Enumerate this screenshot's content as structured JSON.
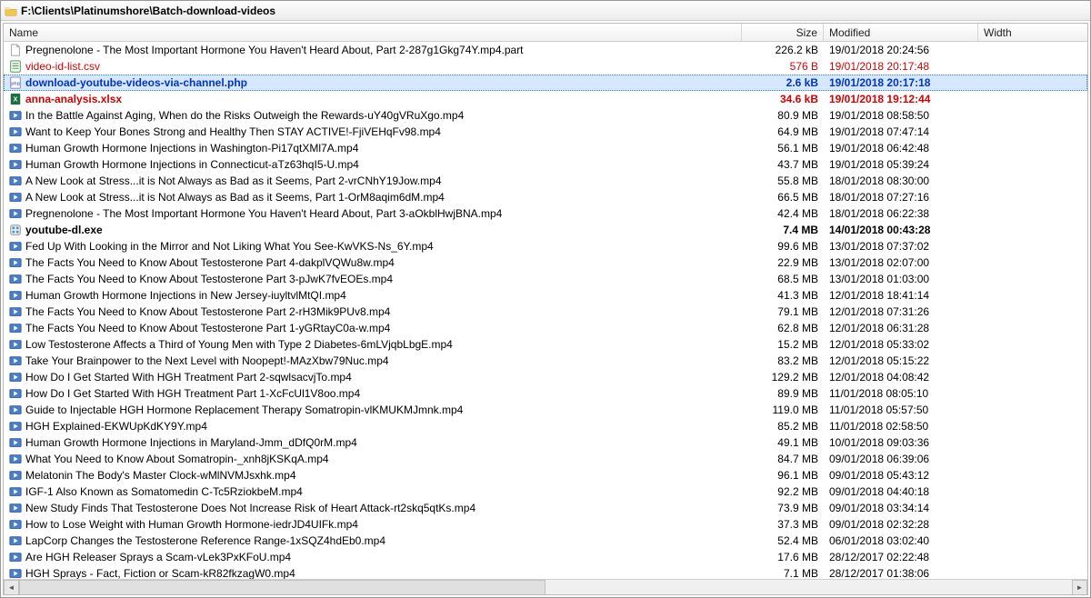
{
  "title": "F:\\Clients\\Platinumshore\\Batch-download-videos",
  "columns": {
    "name": "Name",
    "size": "Size",
    "modified": "Modified",
    "width": "Width"
  },
  "rows": [
    {
      "icon": "file",
      "name": "Pregnenolone - The Most Important Hormone You Haven't Heard About, Part 2-287g1Gkg74Y.mp4.part",
      "size": "226.2 kB",
      "modified": "19/01/2018 20:24:56",
      "style": ""
    },
    {
      "icon": "csv",
      "name": "video-id-list.csv",
      "size": "576 B",
      "modified": "19/01/2018 20:17:48",
      "style": "red"
    },
    {
      "icon": "php",
      "name": "download-youtube-videos-via-channel.php",
      "size": "2.6 kB",
      "modified": "19/01/2018 20:17:18",
      "style": "blue selected"
    },
    {
      "icon": "xlsx",
      "name": "anna-analysis.xlsx",
      "size": "34.6 kB",
      "modified": "19/01/2018 19:12:44",
      "style": "red bold"
    },
    {
      "icon": "video",
      "name": "In the Battle Against Aging, When do the Risks Outweigh the Rewards-uY40gVRuXgo.mp4",
      "size": "80.9 MB",
      "modified": "19/01/2018 08:58:50",
      "style": ""
    },
    {
      "icon": "video",
      "name": "Want to Keep Your Bones Strong and Healthy Then STAY ACTIVE!-FjiVEHqFv98.mp4",
      "size": "64.9 MB",
      "modified": "19/01/2018 07:47:14",
      "style": ""
    },
    {
      "icon": "video",
      "name": "Human Growth Hormone Injections in Washington-Pi17qtXMl7A.mp4",
      "size": "56.1 MB",
      "modified": "19/01/2018 06:42:48",
      "style": ""
    },
    {
      "icon": "video",
      "name": "Human Growth Hormone Injections in Connecticut-aTz63hqI5-U.mp4",
      "size": "43.7 MB",
      "modified": "19/01/2018 05:39:24",
      "style": ""
    },
    {
      "icon": "video",
      "name": "A New Look at Stress...it is Not Always as Bad as it Seems, Part 2-vrCNhY19Jow.mp4",
      "size": "55.8 MB",
      "modified": "18/01/2018 08:30:00",
      "style": ""
    },
    {
      "icon": "video",
      "name": "A New Look at Stress...it is Not Always as Bad as it Seems, Part 1-OrM8aqim6dM.mp4",
      "size": "66.5 MB",
      "modified": "18/01/2018 07:27:16",
      "style": ""
    },
    {
      "icon": "video",
      "name": "Pregnenolone - The Most Important Hormone You Haven't Heard About, Part 3-aOkblHwjBNA.mp4",
      "size": "42.4 MB",
      "modified": "18/01/2018 06:22:38",
      "style": ""
    },
    {
      "icon": "exe",
      "name": "youtube-dl.exe",
      "size": "7.4 MB",
      "modified": "14/01/2018 00:43:28",
      "style": "bold"
    },
    {
      "icon": "video",
      "name": "Fed Up With Looking in the Mirror and Not Liking What You See-KwVKS-Ns_6Y.mp4",
      "size": "99.6 MB",
      "modified": "13/01/2018 07:37:02",
      "style": ""
    },
    {
      "icon": "video",
      "name": "The Facts You Need to Know About Testosterone Part 4-dakplVQWu8w.mp4",
      "size": "22.9 MB",
      "modified": "13/01/2018 02:07:00",
      "style": ""
    },
    {
      "icon": "video",
      "name": "The Facts You Need to Know About Testosterone Part 3-pJwK7fvEOEs.mp4",
      "size": "68.5 MB",
      "modified": "13/01/2018 01:03:00",
      "style": ""
    },
    {
      "icon": "video",
      "name": "Human Growth Hormone Injections in New Jersey-iuyltvlMtQI.mp4",
      "size": "41.3 MB",
      "modified": "12/01/2018 18:41:14",
      "style": ""
    },
    {
      "icon": "video",
      "name": "The Facts You Need to Know About Testosterone Part 2-rH3Mik9PUv8.mp4",
      "size": "79.1 MB",
      "modified": "12/01/2018 07:31:26",
      "style": ""
    },
    {
      "icon": "video",
      "name": "The Facts You Need to Know About Testosterone Part 1-yGRtayC0a-w.mp4",
      "size": "62.8 MB",
      "modified": "12/01/2018 06:31:28",
      "style": ""
    },
    {
      "icon": "video",
      "name": "Low Testosterone Affects a Third of Young Men with Type 2 Diabetes-6mLVjqbLbgE.mp4",
      "size": "15.2 MB",
      "modified": "12/01/2018 05:33:02",
      "style": ""
    },
    {
      "icon": "video",
      "name": "Take Your Brainpower to the Next Level with Noopept!-MAzXbw79Nuc.mp4",
      "size": "83.2 MB",
      "modified": "12/01/2018 05:15:22",
      "style": ""
    },
    {
      "icon": "video",
      "name": "How Do I Get Started With HGH Treatment Part 2-sqwlsacvjTo.mp4",
      "size": "129.2 MB",
      "modified": "12/01/2018 04:08:42",
      "style": ""
    },
    {
      "icon": "video",
      "name": "How Do I Get Started With HGH Treatment Part 1-XcFcUl1V8oo.mp4",
      "size": "89.9 MB",
      "modified": "11/01/2018 08:05:10",
      "style": ""
    },
    {
      "icon": "video",
      "name": "Guide to Injectable HGH Hormone Replacement Therapy Somatropin-vlKMUKMJmnk.mp4",
      "size": "119.0 MB",
      "modified": "11/01/2018 05:57:50",
      "style": ""
    },
    {
      "icon": "video",
      "name": "HGH Explained-EKWUpKdKY9Y.mp4",
      "size": "85.2 MB",
      "modified": "11/01/2018 02:58:50",
      "style": ""
    },
    {
      "icon": "video",
      "name": "Human Growth Hormone Injections in Maryland-Jmm_dDfQ0rM.mp4",
      "size": "49.1 MB",
      "modified": "10/01/2018 09:03:36",
      "style": ""
    },
    {
      "icon": "video",
      "name": "What You Need to Know About Somatropin-_xnh8jKSKqA.mp4",
      "size": "84.7 MB",
      "modified": "09/01/2018 06:39:06",
      "style": ""
    },
    {
      "icon": "video",
      "name": "Melatonin The Body's Master Clock-wMlNVMJsxhk.mp4",
      "size": "96.1 MB",
      "modified": "09/01/2018 05:43:12",
      "style": ""
    },
    {
      "icon": "video",
      "name": "IGF-1 Also Known as Somatomedin C-Tc5RziokbeM.mp4",
      "size": "92.2 MB",
      "modified": "09/01/2018 04:40:18",
      "style": ""
    },
    {
      "icon": "video",
      "name": "New Study Finds That Testosterone Does Not Increase Risk of Heart Attack-rt2skq5qtKs.mp4",
      "size": "73.9 MB",
      "modified": "09/01/2018 03:34:14",
      "style": ""
    },
    {
      "icon": "video",
      "name": "How to Lose Weight with Human Growth Hormone-iedrJD4UIFk.mp4",
      "size": "37.3 MB",
      "modified": "09/01/2018 02:32:28",
      "style": ""
    },
    {
      "icon": "video",
      "name": "LapCorp Changes the Testosterone Reference Range-1xSQZ4hdEb0.mp4",
      "size": "52.4 MB",
      "modified": "06/01/2018 03:02:40",
      "style": ""
    },
    {
      "icon": "video",
      "name": "Are HGH Releaser Sprays a Scam-vLek3PxKFoU.mp4",
      "size": "17.6 MB",
      "modified": "28/12/2017 02:22:48",
      "style": ""
    },
    {
      "icon": "video",
      "name": "HGH Sprays - Fact, Fiction or Scam-kR82fkzagW0.mp4",
      "size": "7.1 MB",
      "modified": "28/12/2017 01:38:06",
      "style": ""
    }
  ]
}
